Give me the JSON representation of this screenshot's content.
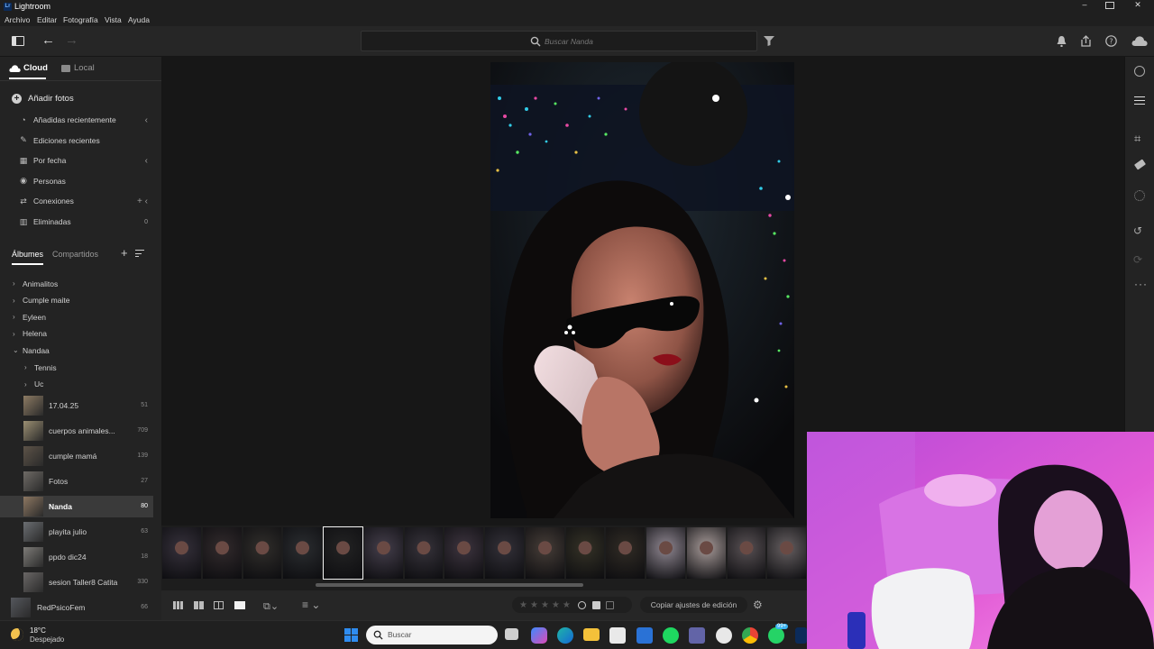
{
  "app": {
    "title": "Lightroom"
  },
  "menu": [
    "Archivo",
    "Editar",
    "Fotografía",
    "Vista",
    "Ayuda"
  ],
  "search": {
    "placeholder": "Buscar Nanda"
  },
  "sidebar": {
    "tabs": {
      "cloud": "Cloud",
      "local": "Local"
    },
    "add_photos": "Añadir fotos",
    "library": [
      {
        "label": "Añadidas recientemente",
        "icon": "clock-icon",
        "trail": "‹"
      },
      {
        "label": "Ediciones recientes",
        "icon": "edit-history-icon",
        "trail": ""
      },
      {
        "label": "Por fecha",
        "icon": "calendar-icon",
        "trail": "‹"
      },
      {
        "label": "Personas",
        "icon": "person-icon",
        "trail": ""
      },
      {
        "label": "Conexiones",
        "icon": "connections-icon",
        "trail": "+ ‹"
      },
      {
        "label": "Eliminadas",
        "icon": "trash-icon",
        "trail": "0"
      }
    ],
    "album_tabs": {
      "albums": "Álbumes",
      "shared": "Compartidos"
    },
    "folders": [
      {
        "label": "Animalitos",
        "expanded": false,
        "indent": 0
      },
      {
        "label": "Cumple maite",
        "expanded": false,
        "indent": 0
      },
      {
        "label": "Eyleen",
        "expanded": false,
        "indent": 0
      },
      {
        "label": "Helena",
        "expanded": false,
        "indent": 0
      },
      {
        "label": "Nandaa",
        "expanded": true,
        "indent": 0
      },
      {
        "label": "Tennis",
        "expanded": false,
        "indent": 1
      },
      {
        "label": "Uc",
        "expanded": false,
        "indent": 1
      }
    ],
    "albums": [
      {
        "label": "17.04.25",
        "count": "51",
        "tone": "#8d7b63",
        "selected": false
      },
      {
        "label": "cuerpos animales...",
        "count": "709",
        "tone": "#9b8f72",
        "selected": false
      },
      {
        "label": "cumple mamá",
        "count": "139",
        "tone": "#5d5348",
        "selected": false
      },
      {
        "label": "Fotos",
        "count": "27",
        "tone": "#6f6b66",
        "selected": false
      },
      {
        "label": "Nanda",
        "count": "80",
        "tone": "#8e7862",
        "selected": true
      },
      {
        "label": "playita julio",
        "count": "63",
        "tone": "#6b6e72",
        "selected": false
      },
      {
        "label": "ppdo dic24",
        "count": "18",
        "tone": "#7e7c78",
        "selected": false
      },
      {
        "label": "sesion Taller8 Catita",
        "count": "330",
        "tone": "#6a6766",
        "selected": false
      },
      {
        "label": "RedPsicoFem",
        "count": "66",
        "tone": "#55575d",
        "selected": false
      }
    ]
  },
  "bottombar": {
    "copy_settings": "Copiar ajustes de edición",
    "stars": [
      "★",
      "★",
      "★",
      "★",
      "★"
    ]
  },
  "filmstrip": {
    "tones": [
      "#2e2a33",
      "#2b2527",
      "#2a2826",
      "#25272a",
      "#1f1f20",
      "#3a3540",
      "#2f2c33",
      "#342d36",
      "#2c2a31",
      "#3b3430",
      "#2d2b22",
      "#2a2621",
      "#777079",
      "#8a807f",
      "#4a4447",
      "#555052"
    ],
    "selected_index": 4
  },
  "taskbar": {
    "weather_temp": "18°C",
    "weather_desc": "Despejado",
    "search_placeholder": "Buscar",
    "badge": "99+"
  },
  "colors": {
    "accent": "#e8e8e8",
    "panel": "#232323",
    "stage": "#171717",
    "selection": "#3c3c3c"
  }
}
